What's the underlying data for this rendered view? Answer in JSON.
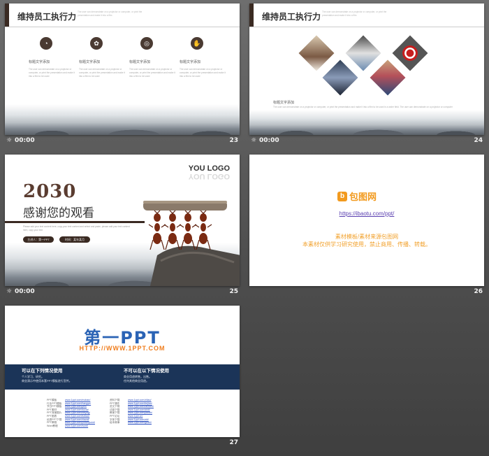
{
  "colors": {
    "accent_brown": "#3a2a22",
    "brand_orange": "#f29a1e",
    "ppt_blue": "#2a63b5",
    "ppt_orange": "#f07e1e",
    "navy": "#1b3458"
  },
  "slides": [
    {
      "number": "23",
      "time": "00:00",
      "clock_icon": "clock-icon",
      "header_title": "维持员工执行力",
      "header_sub": "The user can demonstrate on a projector or computer, or print the presentation and make it into a film",
      "features": [
        {
          "icon": "chart-icon",
          "glyph": "◔",
          "title": "标题文字添加",
          "desc": "The user can demonstrate on a projector or computer, or print the presentation and make it into a film to be used"
        },
        {
          "icon": "people-icon",
          "glyph": "✿",
          "title": "标题文字添加",
          "desc": "The user can demonstrate on a projector or computer, or print the presentation and make it into a film to be used"
        },
        {
          "icon": "target-icon",
          "glyph": "◎",
          "title": "标题文字添加",
          "desc": "The user can demonstrate on a projector or computer, or print the presentation and make it into a film to be used"
        },
        {
          "icon": "handshake-icon",
          "glyph": "✋",
          "title": "标题文字添加",
          "desc": "The user can demonstrate on a projector or computer, or print the presentation and make it into a film to be used"
        }
      ]
    },
    {
      "number": "24",
      "time": "00:00",
      "header_title": "维持员工执行力",
      "header_sub": "The user can demonstrate on a projector or computer, or print the presentation and make it into a film",
      "caption_title": "标题文字添加",
      "caption_desc": "The user can demonstrate on a projector or computer, or print the presentation and make it into a film to be used in a wider field. The user can demonstrate on a projector or computer"
    },
    {
      "number": "25",
      "time": "00:00",
      "logo": "YOU LOGO",
      "year": "2030",
      "thanks": "感谢您的观看",
      "desc": "Please add your text content here, copy your text content and select and paste, please add your text content here, copy your text",
      "pill_1": "主讲人：第一PPT",
      "pill_2": "时间：某年某月"
    },
    {
      "number": "26",
      "brand_glyph": "b",
      "brand": "包图网",
      "url": "https://ibaotu.com/ppt/",
      "line1": "素材模板/素材来源包图网",
      "line2": "本素材仅供学习研究使用，禁止商用、传播、转载。"
    },
    {
      "number": "27",
      "big_title": "第一PPT",
      "site": "HTTP://WWW.1PPT.COM",
      "can_title": "可以在下列情况使用",
      "can_items": [
        "个人学习、研究。",
        "商业演示中使用本套PPT模板进行宣传。"
      ],
      "cannot_title": "不可以在以下情况使用",
      "cannot_items": [
        "商业用途转售，出售。",
        "任何其他商业用途。"
      ],
      "links_left": [
        [
          "PPT模板",
          "www.1ppt.com/moban/"
        ],
        [
          "行业PPT模板",
          "www.1ppt.com/hangye/"
        ],
        [
          "节日PPT模板",
          "www.1ppt.com/jieri/"
        ],
        [
          "PPT素材",
          "www.1ppt.com/sucai/"
        ],
        [
          "PPT背景图片",
          "www.1ppt.com/beijing/"
        ],
        [
          "PPT图表",
          "www.1ppt.com/tubiao/"
        ],
        [
          "优秀PPT下载",
          "www.1ppt.com/xiazai/"
        ],
        [
          "PPT教程",
          "www.1ppt.com/powerpoint/"
        ],
        [
          "Word教程",
          "www.1ppt.com/word/"
        ]
      ],
      "links_right": [
        [
          "资料下载",
          "www.1ppt.com/ziliao/"
        ],
        [
          "PPT课件",
          "www.1ppt.com/kejian/"
        ],
        [
          "范文下载",
          "www.1ppt.com/fanwen/"
        ],
        [
          "试卷下载",
          "www.1ppt.com/shiti/"
        ],
        [
          "教案下载",
          "www.1ppt.com/jiaoan/"
        ],
        [
          "PPT论坛",
          "www.1ppt.cn/"
        ],
        [
          "字体下载",
          "www.1ppt.com/ziti/"
        ],
        [
          "绘本故事",
          "www.1ppt.com/gushi/"
        ]
      ]
    }
  ]
}
